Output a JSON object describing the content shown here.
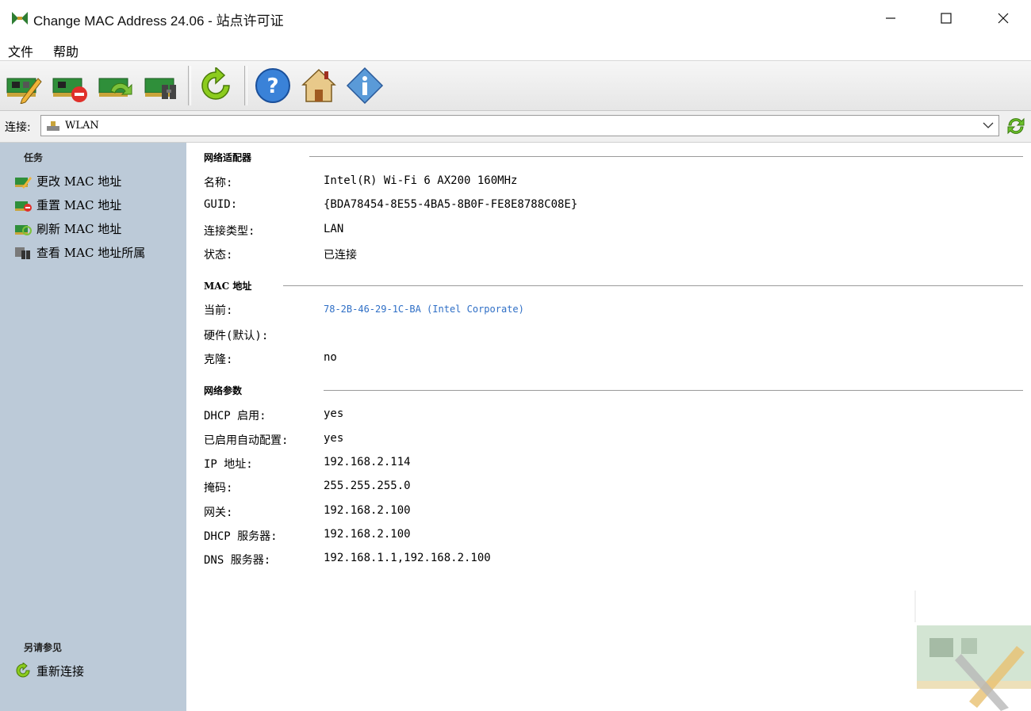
{
  "window": {
    "title": "Change MAC Address 24.06 - 站点许可证"
  },
  "menu": {
    "items": [
      "文件",
      "帮助"
    ]
  },
  "connection": {
    "label": "连接:",
    "value": "WLAN"
  },
  "sidebar": {
    "tasks_heading": "任务",
    "tasks": [
      {
        "label": "更改 MAC 地址"
      },
      {
        "label": "重置 MAC 地址"
      },
      {
        "label": "刷新 MAC 地址"
      },
      {
        "label": "查看 MAC 地址所属"
      }
    ],
    "see_also_heading": "另请参见",
    "see_also": [
      {
        "label": "重新连接"
      }
    ]
  },
  "adapter": {
    "heading": "网络适配器",
    "rows": [
      {
        "label": "名称:",
        "value": "Intel(R) Wi-Fi 6 AX200 160MHz"
      },
      {
        "label": "GUID:",
        "value": "{BDA78454-8E55-4BA5-8B0F-FE8E8788C08E}"
      },
      {
        "label": "连接类型:",
        "value": "LAN"
      },
      {
        "label": "状态:",
        "value": "已连接"
      }
    ]
  },
  "mac": {
    "heading": "MAC 地址",
    "rows": [
      {
        "label": "当前:",
        "value": "78-2B-46-29-1C-BA (Intel Corporate)"
      },
      {
        "label": "硬件(默认):",
        "value": ""
      },
      {
        "label": "克隆:",
        "value": "no"
      }
    ]
  },
  "network": {
    "heading": "网络参数",
    "rows": [
      {
        "label": "DHCP 启用:",
        "value": "yes"
      },
      {
        "label": "已启用自动配置:",
        "value": "yes"
      },
      {
        "label": "IP 地址:",
        "value": "192.168.2.114"
      },
      {
        "label": "掩码:",
        "value": "255.255.255.0"
      },
      {
        "label": "网关:",
        "value": "192.168.2.100"
      },
      {
        "label": "DHCP 服务器:",
        "value": "192.168.2.100"
      },
      {
        "label": "DNS 服务器:",
        "value": "192.168.1.1,192.168.2.100"
      }
    ]
  },
  "colors": {
    "sidebar_bg": "#bccad8",
    "link": "#2f6fc6"
  },
  "icons": {
    "toolbar": [
      "change-mac-icon",
      "reset-mac-icon",
      "refresh-mac-icon",
      "mac-owner-icon",
      "reconnect-icon",
      "help-icon",
      "home-icon",
      "info-icon"
    ]
  }
}
